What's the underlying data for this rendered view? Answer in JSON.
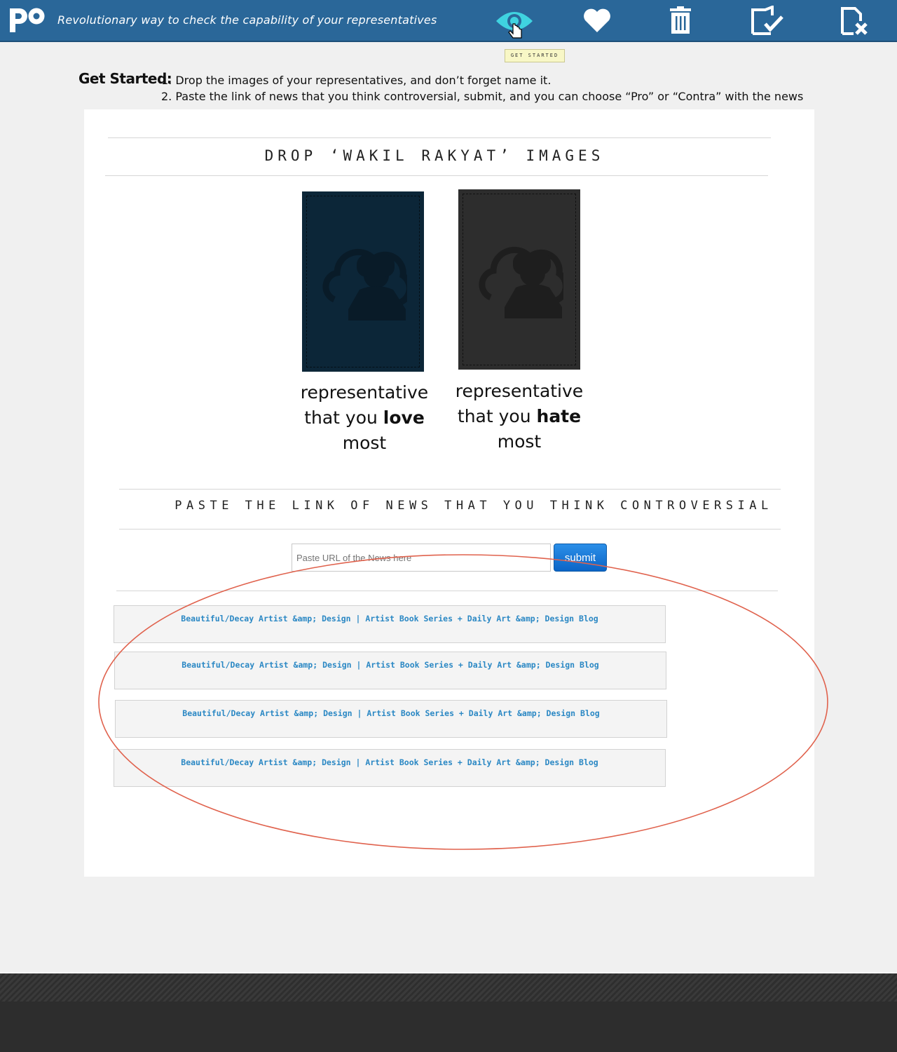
{
  "header": {
    "logo_text": "po",
    "tagline": "Revolutionary way to check the capability of your representatives",
    "icons": [
      "eye-icon",
      "heart-icon",
      "trash-icon",
      "page-check-icon",
      "page-close-icon"
    ],
    "tooltip": "GET STARTED"
  },
  "instructions": {
    "title": "Get Started:",
    "step1": "1. Drop the images of your representatives, and don’t forget name it.",
    "step2": "2. Paste the link of news that you think controversial, submit, and you can choose “Pro” or “Contra” with the news"
  },
  "drop_section": {
    "title": "DROP ‘WAKIL RAKYAT’ IMAGES",
    "love": {
      "line1": "representative",
      "line2_pre": "that you ",
      "line2_bold": "love",
      "line3": "most",
      "color": "#0c2638"
    },
    "hate": {
      "line1": "representative",
      "line2_pre": "that you ",
      "line2_bold": "hate",
      "line3": "most",
      "color": "#2d2d2d"
    }
  },
  "news_section": {
    "title": "PASTE THE LINK OF NEWS THAT YOU THINK CONTROVERSIAL",
    "input_placeholder": "Paste URL of the News here",
    "submit_label": "submit",
    "items": [
      "Beautiful/Decay Artist &amp; Design | Artist Book Series + Daily Art &amp; Design Blog",
      "Beautiful/Decay Artist &amp; Design | Artist Book Series + Daily Art &amp; Design Blog",
      "Beautiful/Decay Artist &amp; Design | Artist Book Series + Daily Art &amp; Design Blog",
      "Beautiful/Decay Artist &amp; Design | Artist Book Series + Daily Art &amp; Design Blog"
    ]
  },
  "colors": {
    "header_bg": "#2a6799",
    "active_icon": "#3fd3e0",
    "annotation_ellipse": "#e0624d",
    "link_text": "#2b88c4"
  }
}
